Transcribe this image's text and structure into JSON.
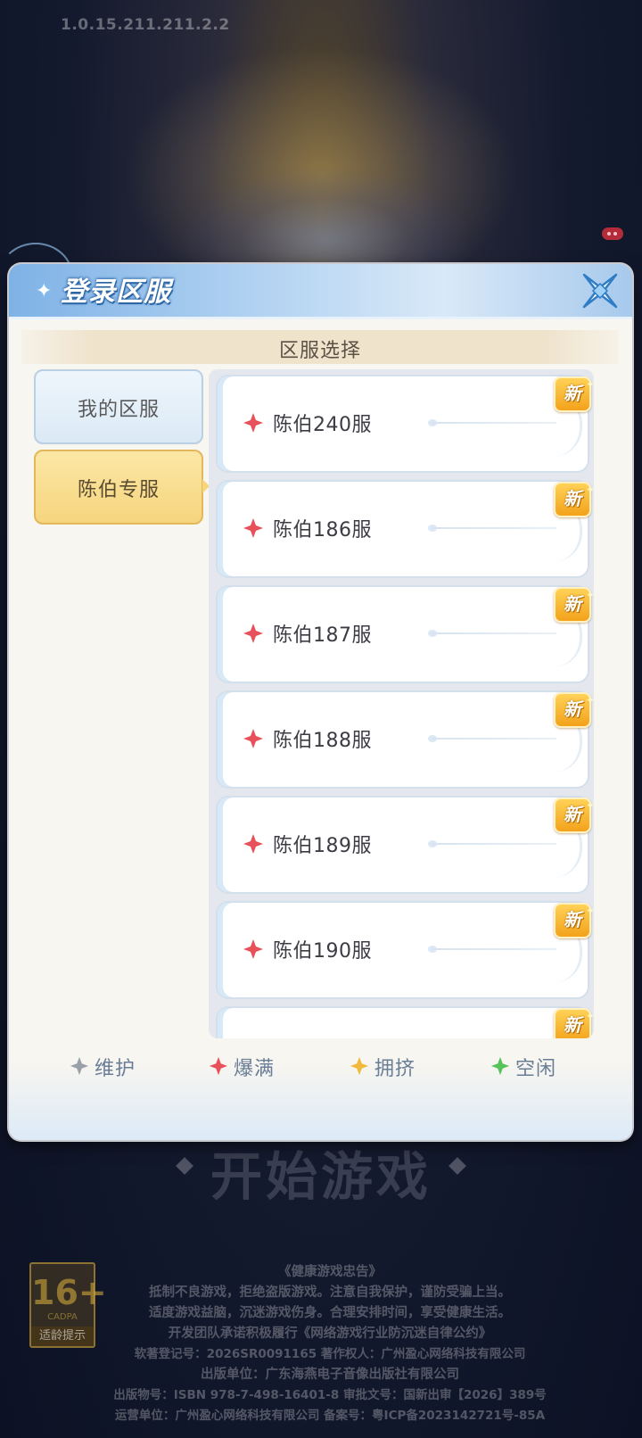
{
  "version": "1.0.15.211.211.2.2",
  "dialog": {
    "title": "登录区服",
    "section_title": "区服选择",
    "tabs": [
      {
        "label": "我的区服",
        "selected": false
      },
      {
        "label": "陈伯专服",
        "selected": true
      }
    ],
    "servers": [
      {
        "name": "陈伯240服",
        "status": "爆满",
        "is_new": true
      },
      {
        "name": "陈伯186服",
        "status": "爆满",
        "is_new": true
      },
      {
        "name": "陈伯187服",
        "status": "爆满",
        "is_new": true
      },
      {
        "name": "陈伯188服",
        "status": "爆满",
        "is_new": true
      },
      {
        "name": "陈伯189服",
        "status": "爆满",
        "is_new": true
      },
      {
        "name": "陈伯190服",
        "status": "爆满",
        "is_new": true
      },
      {
        "name": "",
        "status": "",
        "is_new": true
      }
    ],
    "new_badge": "新",
    "legend": [
      {
        "label": "维护",
        "color": "#9aa0a8"
      },
      {
        "label": "爆满",
        "color": "#e8505a"
      },
      {
        "label": "拥挤",
        "color": "#f2b83a"
      },
      {
        "label": "空闲",
        "color": "#55c25a"
      }
    ]
  },
  "start_button": "开始游戏",
  "age_badge": {
    "age": "16+",
    "org": "CADPA",
    "tip": "适龄提示"
  },
  "legal_lines": [
    "《健康游戏忠告》",
    "抵制不良游戏，拒绝盗版游戏。注意自我保护，谨防受骗上当。",
    "适度游戏益脑，沉迷游戏伤身。合理安排时间，享受健康生活。",
    "开发团队承诺积极履行《网络游戏行业防沉迷自律公约》",
    "软著登记号：2026SR0091165  著作权人：广州盈心网络科技有限公司",
    "出版单位：广东海燕电子音像出版社有限公司",
    "出版物号：ISBN 978-7-498-16401-8 审批文号：国新出审【2026】389号",
    "运营单位：广州盈心网络科技有限公司 备案号：粤ICP备2023142721号-85A"
  ]
}
